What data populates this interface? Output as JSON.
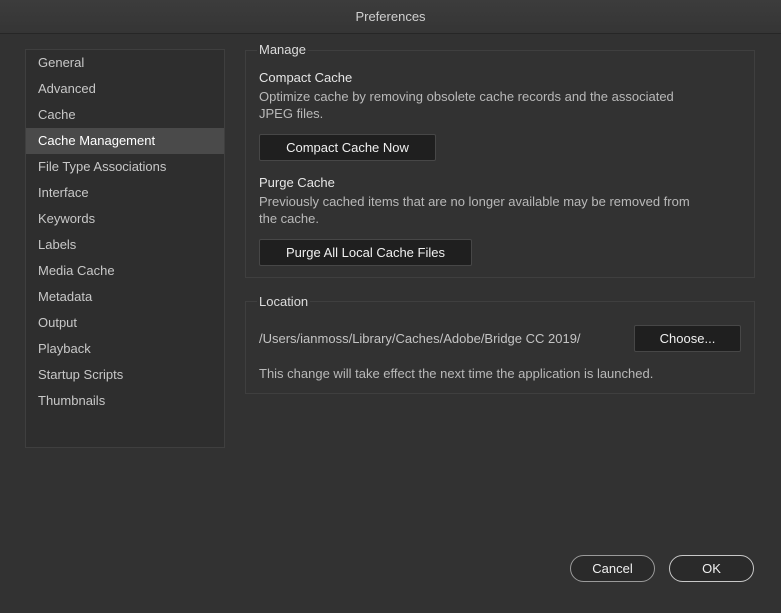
{
  "window": {
    "title": "Preferences"
  },
  "sidebar": {
    "items": [
      {
        "label": "General"
      },
      {
        "label": "Advanced"
      },
      {
        "label": "Cache"
      },
      {
        "label": "Cache Management",
        "selected": true
      },
      {
        "label": "File Type Associations"
      },
      {
        "label": "Interface"
      },
      {
        "label": "Keywords"
      },
      {
        "label": "Labels"
      },
      {
        "label": "Media Cache"
      },
      {
        "label": "Metadata"
      },
      {
        "label": "Output"
      },
      {
        "label": "Playback"
      },
      {
        "label": "Startup Scripts"
      },
      {
        "label": "Thumbnails"
      }
    ]
  },
  "manage": {
    "title": "Manage",
    "compact": {
      "heading": "Compact Cache",
      "desc_line1": "Optimize cache by removing obsolete cache records and the associated",
      "desc_line2": "JPEG files.",
      "button": "Compact Cache Now"
    },
    "purge": {
      "heading": "Purge Cache",
      "desc_line1": "Previously cached items that are no longer available may be removed from",
      "desc_line2": "the cache.",
      "button": "Purge All Local Cache Files"
    }
  },
  "location": {
    "title": "Location",
    "path": "/Users/ianmoss/Library/Caches/Adobe/Bridge CC 2019/",
    "choose_button": "Choose...",
    "note": "This change will take effect the next time the application is launched."
  },
  "footer": {
    "cancel": "Cancel",
    "ok": "OK"
  }
}
